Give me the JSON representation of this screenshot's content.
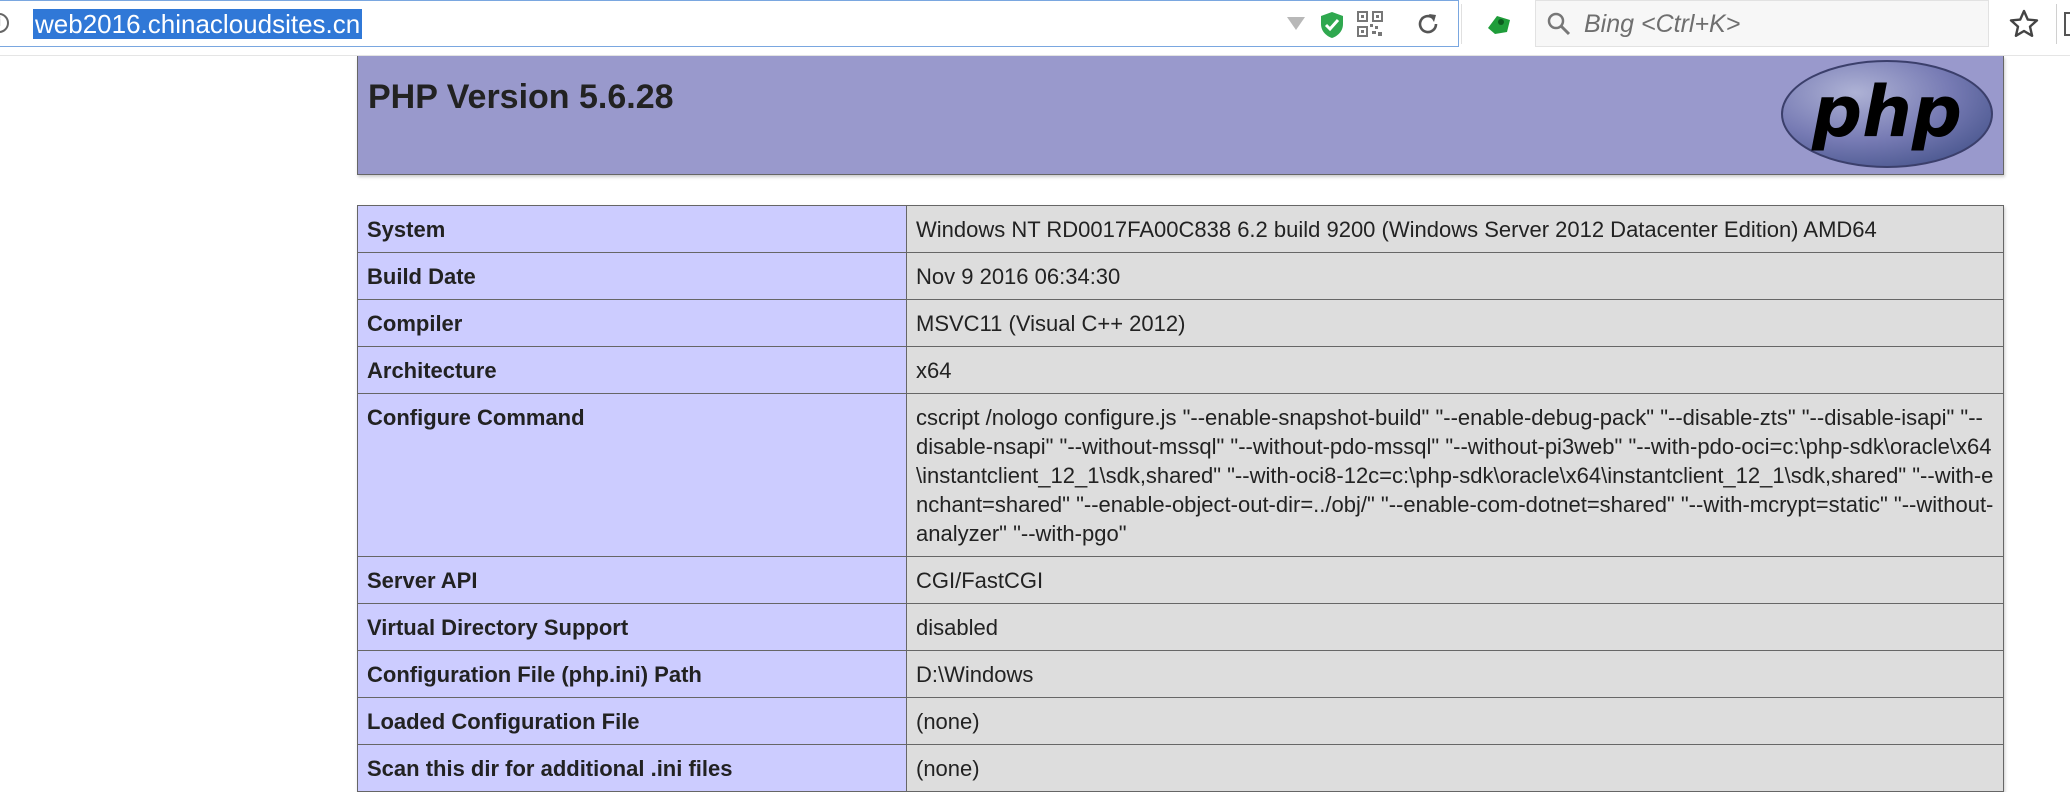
{
  "browser": {
    "url": "web2016.chinacloudsites.cn",
    "search_placeholder": "Bing <Ctrl+K>"
  },
  "phpinfo": {
    "version_title": "PHP Version 5.6.28",
    "logo_text": "php",
    "rows": [
      {
        "label": "System",
        "value": "Windows NT RD0017FA00C838 6.2 build 9200 (Windows Server 2012 Datacenter Edition) AMD64"
      },
      {
        "label": "Build Date",
        "value": "Nov 9 2016 06:34:30"
      },
      {
        "label": "Compiler",
        "value": "MSVC11 (Visual C++ 2012)"
      },
      {
        "label": "Architecture",
        "value": "x64"
      },
      {
        "label": "Configure Command",
        "value": "cscript /nologo configure.js \"--enable-snapshot-build\" \"--enable-debug-pack\" \"--disable-zts\" \"--disable-isapi\" \"--disable-nsapi\" \"--without-mssql\" \"--without-pdo-mssql\" \"--without-pi3web\" \"--with-pdo-oci=c:\\php-sdk\\oracle\\x64\\instantclient_12_1\\sdk,shared\" \"--with-oci8-12c=c:\\php-sdk\\oracle\\x64\\instantclient_12_1\\sdk,shared\" \"--with-enchant=shared\" \"--enable-object-out-dir=../obj/\" \"--enable-com-dotnet=shared\" \"--with-mcrypt=static\" \"--without-analyzer\" \"--with-pgo\""
      },
      {
        "label": "Server API",
        "value": "CGI/FastCGI"
      },
      {
        "label": "Virtual Directory Support",
        "value": "disabled"
      },
      {
        "label": "Configuration File (php.ini) Path",
        "value": "D:\\Windows"
      },
      {
        "label": "Loaded Configuration File",
        "value": "(none)"
      },
      {
        "label": "Scan this dir for additional .ini files",
        "value": "(none)"
      }
    ]
  },
  "icons": {
    "info": "info-icon",
    "dropdown": "chevron-down-icon",
    "shield": "shield-icon",
    "qr": "qr-code-icon",
    "reload": "reload-icon",
    "extension": "extension-icon",
    "search": "search-icon",
    "bookmark": "star-icon"
  },
  "colors": {
    "header_bg": "#9999cc",
    "label_bg": "#ccccff",
    "value_bg": "#dddddd",
    "url_selection": "#3078d7"
  }
}
